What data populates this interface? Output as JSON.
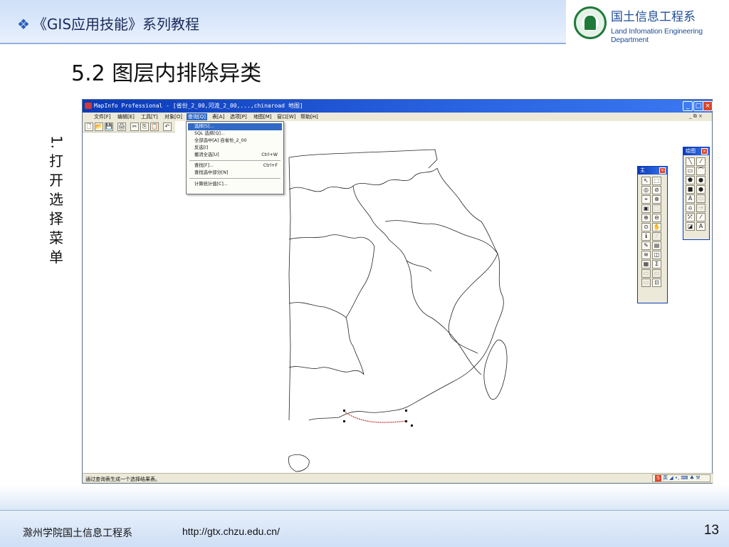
{
  "header": {
    "bullet": "❖",
    "course_title": "《GIS应用技能》系列教程",
    "dept_cn": "国土信息工程系",
    "dept_en": "Land Infomation Engineering Department"
  },
  "page": {
    "title": "5.2 图层内排除异类",
    "step_number": "1.",
    "step_chars": [
      "打",
      "开",
      "选",
      "择",
      "菜",
      "单"
    ]
  },
  "window": {
    "title": "MapInfo Professional - [省份_2_00,河流_2_00,...,chinaroad 地图]",
    "controls": [
      "_",
      "□",
      "×"
    ],
    "menu": [
      {
        "label": "文件[F]"
      },
      {
        "label": "编辑[E]"
      },
      {
        "label": "工具[T]"
      },
      {
        "label": "对象[O]"
      },
      {
        "label": "查询[Q]",
        "active": true
      },
      {
        "label": "表[A]"
      },
      {
        "label": "选项[P]"
      },
      {
        "label": "地图[M]"
      },
      {
        "label": "窗口[W]"
      },
      {
        "label": "帮助[H]"
      }
    ],
    "mdi_controls": "_ ⧉ ×",
    "toolbar": [
      "🗋",
      "📂",
      "💾",
      "🖨",
      "✂",
      "⎘",
      "📋",
      "↶"
    ],
    "dropdown": {
      "items": [
        {
          "label": "选择[S]...",
          "shortcut": "",
          "highlighted": true
        },
        {
          "label": "SQL 选择[Q]...",
          "shortcut": ""
        },
        {
          "label": "全部选中[A] 自省份_2_00",
          "shortcut": ""
        },
        {
          "label": "反选[I]",
          "shortcut": ""
        },
        {
          "label": "撤消全选[U]",
          "shortcut": "Ctrl+W"
        },
        {
          "label": "查找[F]...",
          "shortcut": "Ctrl+F"
        },
        {
          "label": "查找选中部分[N]",
          "shortcut": ""
        },
        {
          "label": "计算统计值[C]...",
          "shortcut": ""
        }
      ]
    },
    "main_palette": {
      "title": "主",
      "close": "×",
      "buttons": [
        "↖",
        "⬚",
        "◎",
        "⊘",
        "⌖",
        "⊗",
        "▣",
        "⬚",
        "⊕",
        "⊖",
        "⊙",
        "✋",
        "ℹ",
        "⁄",
        "✎",
        "▤",
        "≋",
        "◫",
        "▦",
        "Σ",
        "▭",
        "▭",
        "▭",
        "⊡"
      ],
      "disabled": [
        7,
        13,
        20,
        21,
        22
      ]
    },
    "draw_palette": {
      "title": "绘图",
      "close": "×",
      "buttons": [
        "╲",
        "⁄",
        "▭",
        "⌒",
        "⬟",
        "●",
        "■",
        "●",
        "A",
        "▭",
        "⌂",
        "⇢",
        "⤱",
        "⁄",
        "◪",
        "A"
      ],
      "disabled": [
        9,
        11
      ]
    },
    "status": "通过查询表生成一个选择结果表。",
    "ime": "英 ◢ •, ⌨ ♣ ⚒",
    "ime_s": "S"
  },
  "footer": {
    "school": "滁州学院国土信息工程系",
    "url": "http://gtx.chzu.edu.cn/",
    "page_number": "13"
  }
}
